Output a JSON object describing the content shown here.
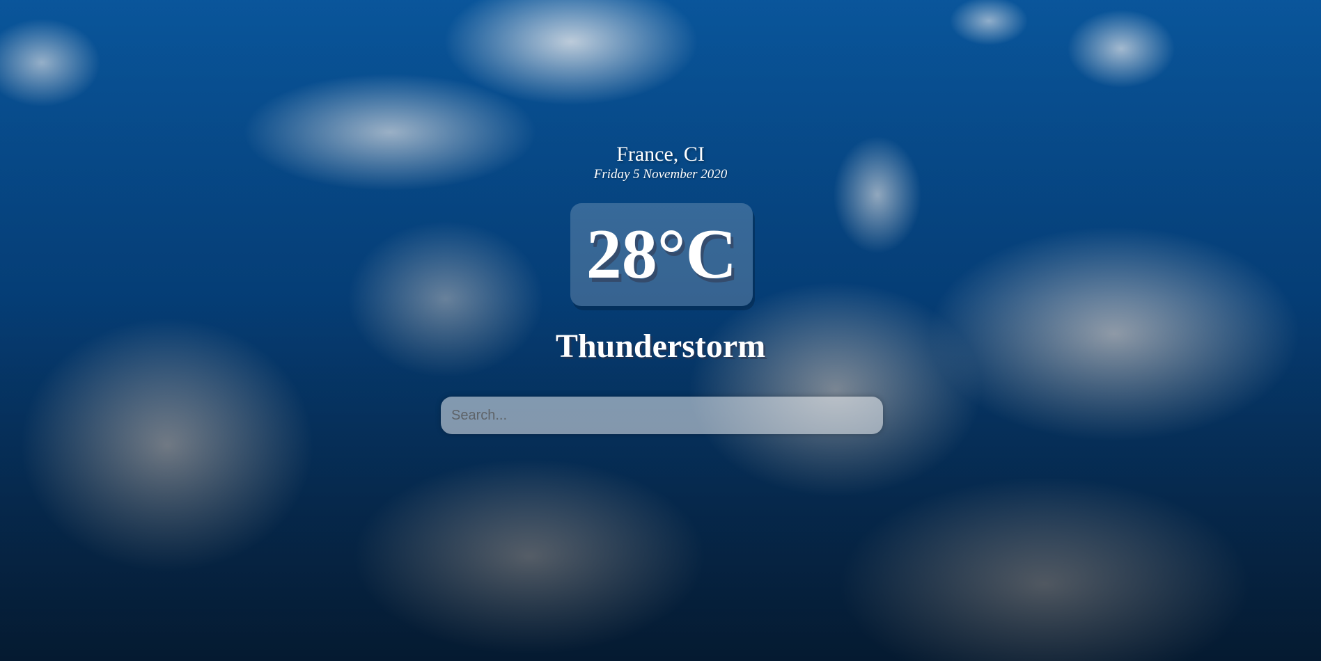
{
  "location": {
    "city": "France, CI",
    "date": "Friday 5 November 2020"
  },
  "weather": {
    "temperature": "28°C",
    "condition": "Thunderstorm"
  },
  "search": {
    "value": "",
    "placeholder": "Search..."
  }
}
